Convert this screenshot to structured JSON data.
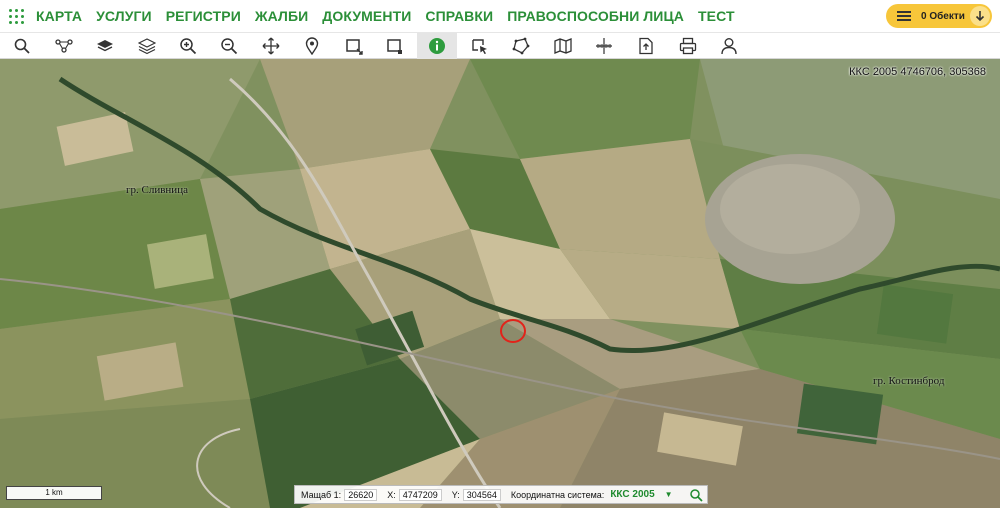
{
  "nav": {
    "apps_icon": "grid-dots-icon",
    "items": [
      {
        "label": "КАРТА"
      },
      {
        "label": "УСЛУГИ"
      },
      {
        "label": "РЕГИСТРИ"
      },
      {
        "label": "ЖАЛБИ"
      },
      {
        "label": "ДОКУМЕНТИ"
      },
      {
        "label": "СПРАВКИ"
      },
      {
        "label": "ПРАВОСПОСОБНИ ЛИЦА"
      },
      {
        "label": "ТЕСТ"
      }
    ],
    "objects_button": {
      "label": "0 Обекти",
      "icon": "hamburger-icon",
      "arrow_icon": "arrow-down-icon"
    },
    "accent_color": "#2b8f38",
    "objects_color": "#f7c63a"
  },
  "toolbar": {
    "tools": [
      {
        "icon": "search-icon"
      },
      {
        "icon": "route-icon"
      },
      {
        "icon": "base-layers-icon"
      },
      {
        "icon": "layers-icon"
      },
      {
        "icon": "zoom-in-icon"
      },
      {
        "icon": "zoom-out-icon"
      },
      {
        "icon": "pan-icon"
      },
      {
        "icon": "location-pin-icon"
      },
      {
        "icon": "select-rectangle-icon"
      },
      {
        "icon": "select-clear-icon"
      },
      {
        "icon": "info-icon",
        "active": true
      },
      {
        "icon": "identify-parcel-icon"
      },
      {
        "icon": "draw-polygon-icon"
      },
      {
        "icon": "map-sheets-icon"
      },
      {
        "icon": "measure-icon"
      },
      {
        "icon": "export-icon"
      },
      {
        "icon": "print-icon"
      },
      {
        "icon": "user-icon"
      }
    ]
  },
  "map": {
    "coordinate_readout": "ККС 2005 4746706, 305368",
    "places": [
      {
        "label": "гр. Сливница"
      },
      {
        "label": "гр. Костинброд"
      }
    ],
    "scale_bar": "1 km",
    "status": {
      "scale_label": "Мащаб 1:",
      "scale_value": "26620",
      "x_label": "X:",
      "x_value": "4747209",
      "y_label": "Y:",
      "y_value": "304564",
      "system_label": "Координатна система:",
      "system_value": "ККС 2005",
      "search_icon": "search-icon"
    }
  }
}
